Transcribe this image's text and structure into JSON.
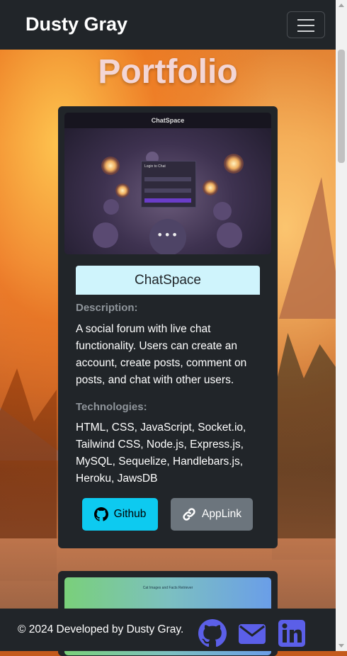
{
  "navbar": {
    "brand": "Dusty Gray"
  },
  "page": {
    "title": "Portfolio"
  },
  "project": {
    "image_title": "ChatSpace",
    "image_login_title": "Login to Chat",
    "name": "ChatSpace",
    "description_label": "Description:",
    "description": "A social forum with live chat functionality. Users can create an account, create posts, comment on posts, and chat with other users.",
    "technologies_label": "Technologies:",
    "technologies": "HTML, CSS, JavaScript, Socket.io, Tailwind CSS, Node.js, Express.js, MySQL, Sequelize, Handlebars.js, Heroku, JawsDB",
    "github_label": "Github",
    "applink_label": "AppLink"
  },
  "next_project": {
    "image_title": "Cat Images and Facts Retriever"
  },
  "footer": {
    "text": "© 2024 Developed by Dusty Gray.",
    "icons": [
      "github-icon",
      "email-icon",
      "linkedin-icon"
    ],
    "icon_color": "#5b5fe8"
  },
  "colors": {
    "navbar_bg": "#212529",
    "card_bg": "#212529",
    "header_bg": "#cff4fc",
    "github_btn": "#0dcaf0",
    "applink_btn": "#6c757d",
    "title_color": "#f3d6d6"
  }
}
